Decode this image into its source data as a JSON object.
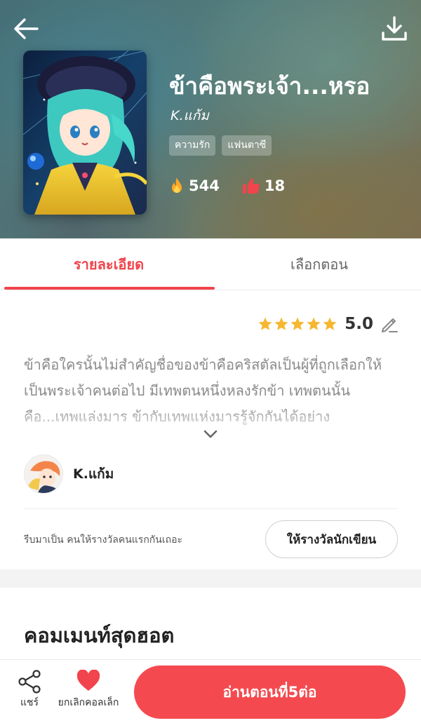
{
  "header": {
    "back_icon": "arrow-left-icon",
    "download_icon": "download-icon"
  },
  "book": {
    "title": "ข้าคือพระเจ้า...หรอ",
    "author": "K.แก้ม",
    "tags": [
      "ความรัก",
      "แฟนตาซี"
    ],
    "views": "544",
    "likes": "18",
    "views_icon": "flame-icon",
    "likes_icon": "thumbs-up-icon"
  },
  "tabs": {
    "detail": "รายละเอียด",
    "chapters": "เลือกตอน"
  },
  "detail": {
    "rating": "5.0",
    "stars": 5,
    "synopsis": "ข้าคือใครนั้นไม่สำคัญชื่อของข้าคือคริสตัลเป็นผู้ที่ถูกเลือกให้เป็นพระเจ้าคนต่อไป  มีเทพตนหนึ่งหลงรักข้า  เทพตนนั้นคือ...เทพแล่งมาร  ข้ากับเทพแห่งมารรู้จักกันได้อย่าง",
    "writer_name": "K.แก้ม",
    "reward_hint": "รีบมาเป็น คนให้รางวัลคนแรกกันเถอะ",
    "reward_button": "ให้รางวัลนักเขียน"
  },
  "comments": {
    "title": "คอมเมนท์สุดฮอต"
  },
  "bottom_bar": {
    "share_label": "แชร์",
    "favorite_label": "ยกเลิกคอลเล็ก",
    "read_button": "อ่านตอนที่5ต่อ"
  },
  "colors": {
    "accent": "#f1444c",
    "star": "#f7b731",
    "read_button": "#f44a4f"
  }
}
